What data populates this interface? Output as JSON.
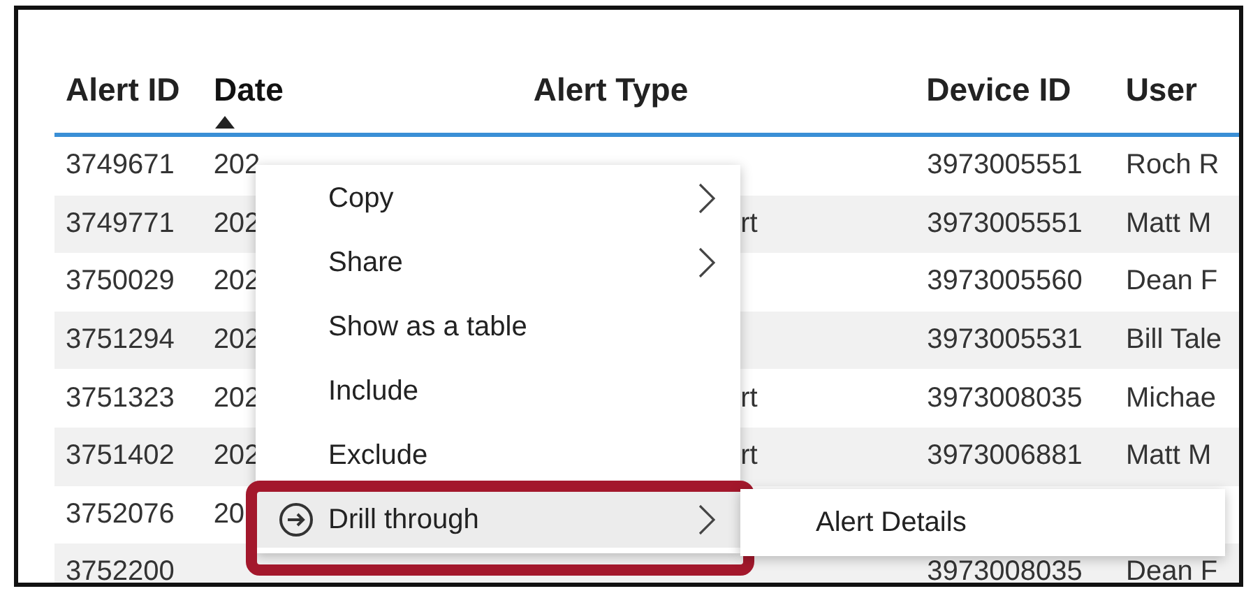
{
  "table": {
    "columns": [
      {
        "label": "Alert ID",
        "sorted": false
      },
      {
        "label": "Date",
        "sorted": true
      },
      {
        "label": "Alert Type",
        "sorted": false
      },
      {
        "label": "Device ID",
        "sorted": false
      },
      {
        "label": "User",
        "sorted": false
      }
    ],
    "rows": [
      [
        "3749671",
        "202",
        "",
        "3973005551",
        "Roch R"
      ],
      [
        "3749771",
        "202",
        "rt",
        "3973005551",
        "Matt M"
      ],
      [
        "3750029",
        "202",
        "",
        "3973005560",
        "Dean F"
      ],
      [
        "3751294",
        "202",
        "",
        "3973005531",
        "Bill Tale"
      ],
      [
        "3751323",
        "202",
        "rt",
        "3973008035",
        "Michae"
      ],
      [
        "3751402",
        "202",
        "rt",
        "3973006881",
        "Matt M"
      ],
      [
        "3752076",
        "20",
        "",
        "",
        ""
      ],
      [
        "3752200",
        "",
        "",
        "3973008035",
        "Dean F"
      ]
    ]
  },
  "context_menu": {
    "items": [
      {
        "label": "Copy",
        "submenu": true,
        "icon": false,
        "selected": false
      },
      {
        "label": "Share",
        "submenu": true,
        "icon": false,
        "selected": false
      },
      {
        "label": "Show as a table",
        "submenu": false,
        "icon": false,
        "selected": false
      },
      {
        "label": "Include",
        "submenu": false,
        "icon": false,
        "selected": false
      },
      {
        "label": "Exclude",
        "submenu": false,
        "icon": false,
        "selected": false
      },
      {
        "label": "Drill through",
        "submenu": true,
        "icon": true,
        "selected": true
      }
    ],
    "submenu": {
      "items": [
        {
          "label": "Alert Details"
        }
      ]
    }
  }
}
